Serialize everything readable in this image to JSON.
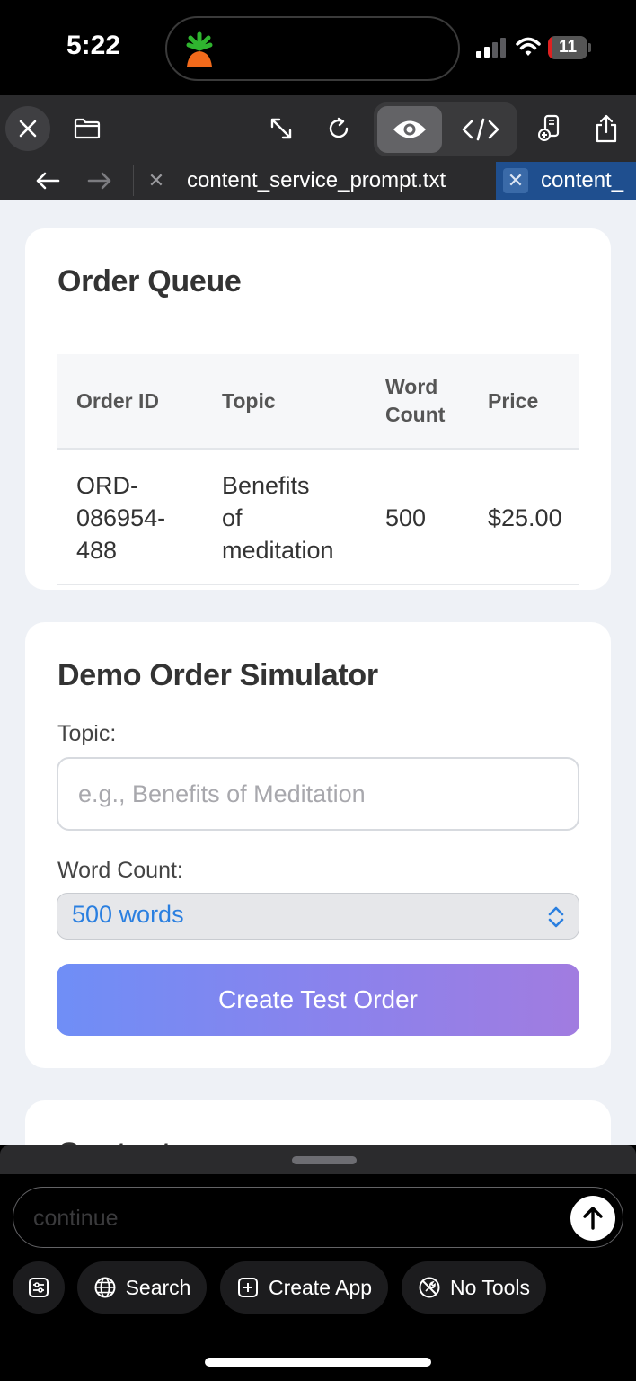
{
  "status_bar": {
    "time": "5:22",
    "battery_level": "11",
    "battery_fraction": 0.11
  },
  "browser": {
    "tabs": [
      {
        "label": "content_service_prompt.txt",
        "active": false
      },
      {
        "label": "content_",
        "active": true
      }
    ]
  },
  "order_queue": {
    "title": "Order Queue",
    "headers": [
      "Order ID",
      "Topic",
      "Word\nCount",
      "Price"
    ],
    "rows": [
      {
        "order_id": "ORD-\n086954-\n488",
        "topic": "Benefits\nof\nmeditation",
        "word_count": "500",
        "price": "$25.00"
      }
    ]
  },
  "simulator": {
    "title": "Demo Order Simulator",
    "topic_label": "Topic:",
    "topic_placeholder": "e.g., Benefits of Meditation",
    "topic_value": "",
    "word_count_label": "Word Count:",
    "word_count_value": "500 words",
    "submit_label": "Create Test Order"
  },
  "next_card": {
    "title_partial": "Content..."
  },
  "assistant_bar": {
    "prompt_placeholder": "continue",
    "chips": [
      "Search",
      "Create App",
      "No Tools"
    ]
  },
  "colors": {
    "accent_blue": "#2a7fe0",
    "button_gradient_start": "#6f8ef6",
    "button_gradient_end": "#a17ce0",
    "tab_active": "#1f4f8f",
    "page_bg": "#eef1f6"
  }
}
